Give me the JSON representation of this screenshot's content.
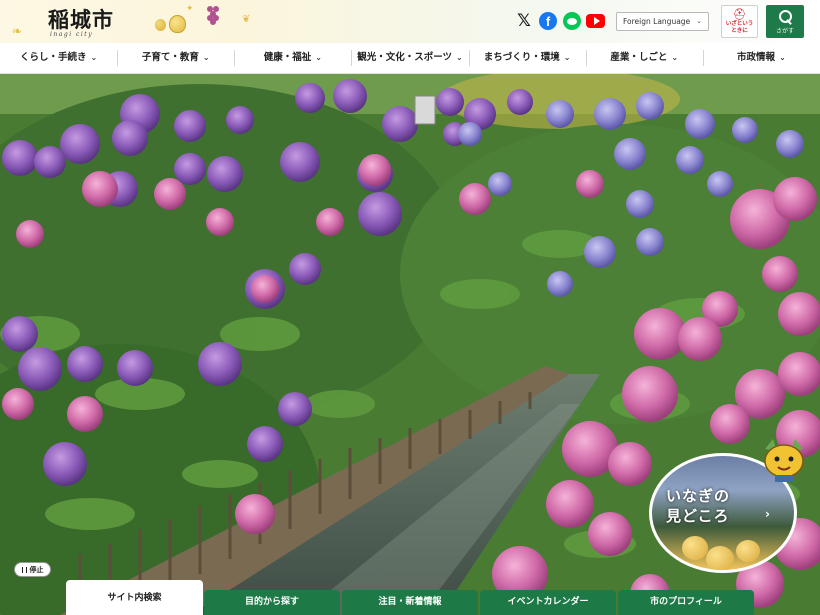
{
  "header": {
    "logo_text": "稲城市",
    "logo_sub": "inagi city",
    "language_label": "Foreign Language",
    "emergency_label": "いざという\nときに",
    "search_label": "さがす",
    "sns": [
      "x-icon",
      "facebook-icon",
      "line-icon",
      "youtube-icon"
    ]
  },
  "nav": {
    "items": [
      {
        "label": "くらし・手続き"
      },
      {
        "label": "子育て・教育"
      },
      {
        "label": "健康・福祉"
      },
      {
        "label": "観光・文化・スポーツ"
      },
      {
        "label": "まちづくり・環境"
      },
      {
        "label": "産業・しごと"
      },
      {
        "label": "市政情報"
      }
    ]
  },
  "hero": {
    "pause_label": "停止",
    "highlight_label_1": "いなぎの",
    "highlight_label_2": "見どころ"
  },
  "tabs": [
    {
      "label": "サイト内検索",
      "active": true
    },
    {
      "label": "目的から探す"
    },
    {
      "label": "注目・新着情報"
    },
    {
      "label": "イベントカレンダー"
    },
    {
      "label": "市のプロフィール"
    }
  ],
  "colors": {
    "brand_green": "#1d7a47",
    "emergency_red": "#d6222a",
    "hydrangea_purple": "#8a5bb8",
    "hydrangea_pink": "#d06aa8"
  }
}
